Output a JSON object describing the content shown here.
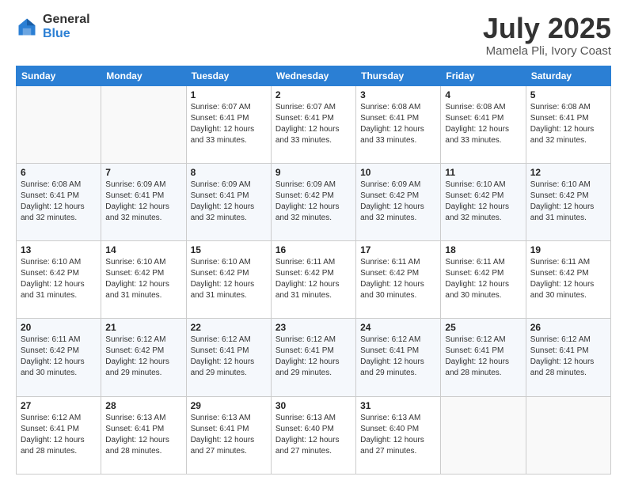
{
  "logo": {
    "general": "General",
    "blue": "Blue"
  },
  "header": {
    "month": "July 2025",
    "location": "Mamela Pli, Ivory Coast"
  },
  "weekdays": [
    "Sunday",
    "Monday",
    "Tuesday",
    "Wednesday",
    "Thursday",
    "Friday",
    "Saturday"
  ],
  "weeks": [
    [
      {
        "day": "",
        "info": ""
      },
      {
        "day": "",
        "info": ""
      },
      {
        "day": "1",
        "info": "Sunrise: 6:07 AM\nSunset: 6:41 PM\nDaylight: 12 hours and 33 minutes."
      },
      {
        "day": "2",
        "info": "Sunrise: 6:07 AM\nSunset: 6:41 PM\nDaylight: 12 hours and 33 minutes."
      },
      {
        "day": "3",
        "info": "Sunrise: 6:08 AM\nSunset: 6:41 PM\nDaylight: 12 hours and 33 minutes."
      },
      {
        "day": "4",
        "info": "Sunrise: 6:08 AM\nSunset: 6:41 PM\nDaylight: 12 hours and 33 minutes."
      },
      {
        "day": "5",
        "info": "Sunrise: 6:08 AM\nSunset: 6:41 PM\nDaylight: 12 hours and 32 minutes."
      }
    ],
    [
      {
        "day": "6",
        "info": "Sunrise: 6:08 AM\nSunset: 6:41 PM\nDaylight: 12 hours and 32 minutes."
      },
      {
        "day": "7",
        "info": "Sunrise: 6:09 AM\nSunset: 6:41 PM\nDaylight: 12 hours and 32 minutes."
      },
      {
        "day": "8",
        "info": "Sunrise: 6:09 AM\nSunset: 6:41 PM\nDaylight: 12 hours and 32 minutes."
      },
      {
        "day": "9",
        "info": "Sunrise: 6:09 AM\nSunset: 6:42 PM\nDaylight: 12 hours and 32 minutes."
      },
      {
        "day": "10",
        "info": "Sunrise: 6:09 AM\nSunset: 6:42 PM\nDaylight: 12 hours and 32 minutes."
      },
      {
        "day": "11",
        "info": "Sunrise: 6:10 AM\nSunset: 6:42 PM\nDaylight: 12 hours and 32 minutes."
      },
      {
        "day": "12",
        "info": "Sunrise: 6:10 AM\nSunset: 6:42 PM\nDaylight: 12 hours and 31 minutes."
      }
    ],
    [
      {
        "day": "13",
        "info": "Sunrise: 6:10 AM\nSunset: 6:42 PM\nDaylight: 12 hours and 31 minutes."
      },
      {
        "day": "14",
        "info": "Sunrise: 6:10 AM\nSunset: 6:42 PM\nDaylight: 12 hours and 31 minutes."
      },
      {
        "day": "15",
        "info": "Sunrise: 6:10 AM\nSunset: 6:42 PM\nDaylight: 12 hours and 31 minutes."
      },
      {
        "day": "16",
        "info": "Sunrise: 6:11 AM\nSunset: 6:42 PM\nDaylight: 12 hours and 31 minutes."
      },
      {
        "day": "17",
        "info": "Sunrise: 6:11 AM\nSunset: 6:42 PM\nDaylight: 12 hours and 30 minutes."
      },
      {
        "day": "18",
        "info": "Sunrise: 6:11 AM\nSunset: 6:42 PM\nDaylight: 12 hours and 30 minutes."
      },
      {
        "day": "19",
        "info": "Sunrise: 6:11 AM\nSunset: 6:42 PM\nDaylight: 12 hours and 30 minutes."
      }
    ],
    [
      {
        "day": "20",
        "info": "Sunrise: 6:11 AM\nSunset: 6:42 PM\nDaylight: 12 hours and 30 minutes."
      },
      {
        "day": "21",
        "info": "Sunrise: 6:12 AM\nSunset: 6:42 PM\nDaylight: 12 hours and 29 minutes."
      },
      {
        "day": "22",
        "info": "Sunrise: 6:12 AM\nSunset: 6:41 PM\nDaylight: 12 hours and 29 minutes."
      },
      {
        "day": "23",
        "info": "Sunrise: 6:12 AM\nSunset: 6:41 PM\nDaylight: 12 hours and 29 minutes."
      },
      {
        "day": "24",
        "info": "Sunrise: 6:12 AM\nSunset: 6:41 PM\nDaylight: 12 hours and 29 minutes."
      },
      {
        "day": "25",
        "info": "Sunrise: 6:12 AM\nSunset: 6:41 PM\nDaylight: 12 hours and 28 minutes."
      },
      {
        "day": "26",
        "info": "Sunrise: 6:12 AM\nSunset: 6:41 PM\nDaylight: 12 hours and 28 minutes."
      }
    ],
    [
      {
        "day": "27",
        "info": "Sunrise: 6:12 AM\nSunset: 6:41 PM\nDaylight: 12 hours and 28 minutes."
      },
      {
        "day": "28",
        "info": "Sunrise: 6:13 AM\nSunset: 6:41 PM\nDaylight: 12 hours and 28 minutes."
      },
      {
        "day": "29",
        "info": "Sunrise: 6:13 AM\nSunset: 6:41 PM\nDaylight: 12 hours and 27 minutes."
      },
      {
        "day": "30",
        "info": "Sunrise: 6:13 AM\nSunset: 6:40 PM\nDaylight: 12 hours and 27 minutes."
      },
      {
        "day": "31",
        "info": "Sunrise: 6:13 AM\nSunset: 6:40 PM\nDaylight: 12 hours and 27 minutes."
      },
      {
        "day": "",
        "info": ""
      },
      {
        "day": "",
        "info": ""
      }
    ]
  ]
}
